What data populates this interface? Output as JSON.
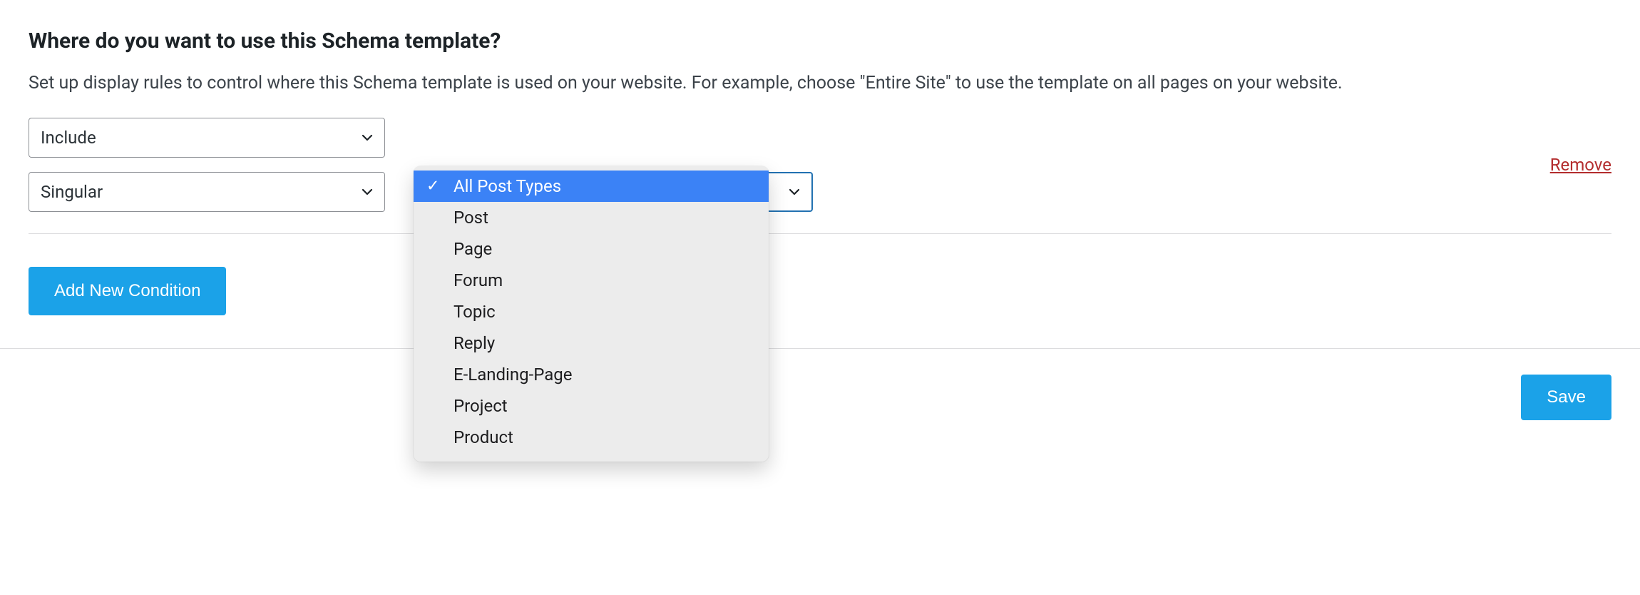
{
  "heading": "Where do you want to use this Schema template?",
  "description": "Set up display rules to control where this Schema template is used on your website. For example, choose \"Entire Site\" to use the template on all pages on your website.",
  "condition": {
    "include_select_value": "Include",
    "scope_select_value": "Singular",
    "remove_label": "Remove"
  },
  "dropdown": {
    "selected_index": 0,
    "options": [
      "All Post Types",
      "Post",
      "Page",
      "Forum",
      "Topic",
      "Reply",
      "E-Landing-Page",
      "Project",
      "Product"
    ]
  },
  "add_button_label": "Add New Condition",
  "save_button_label": "Save"
}
